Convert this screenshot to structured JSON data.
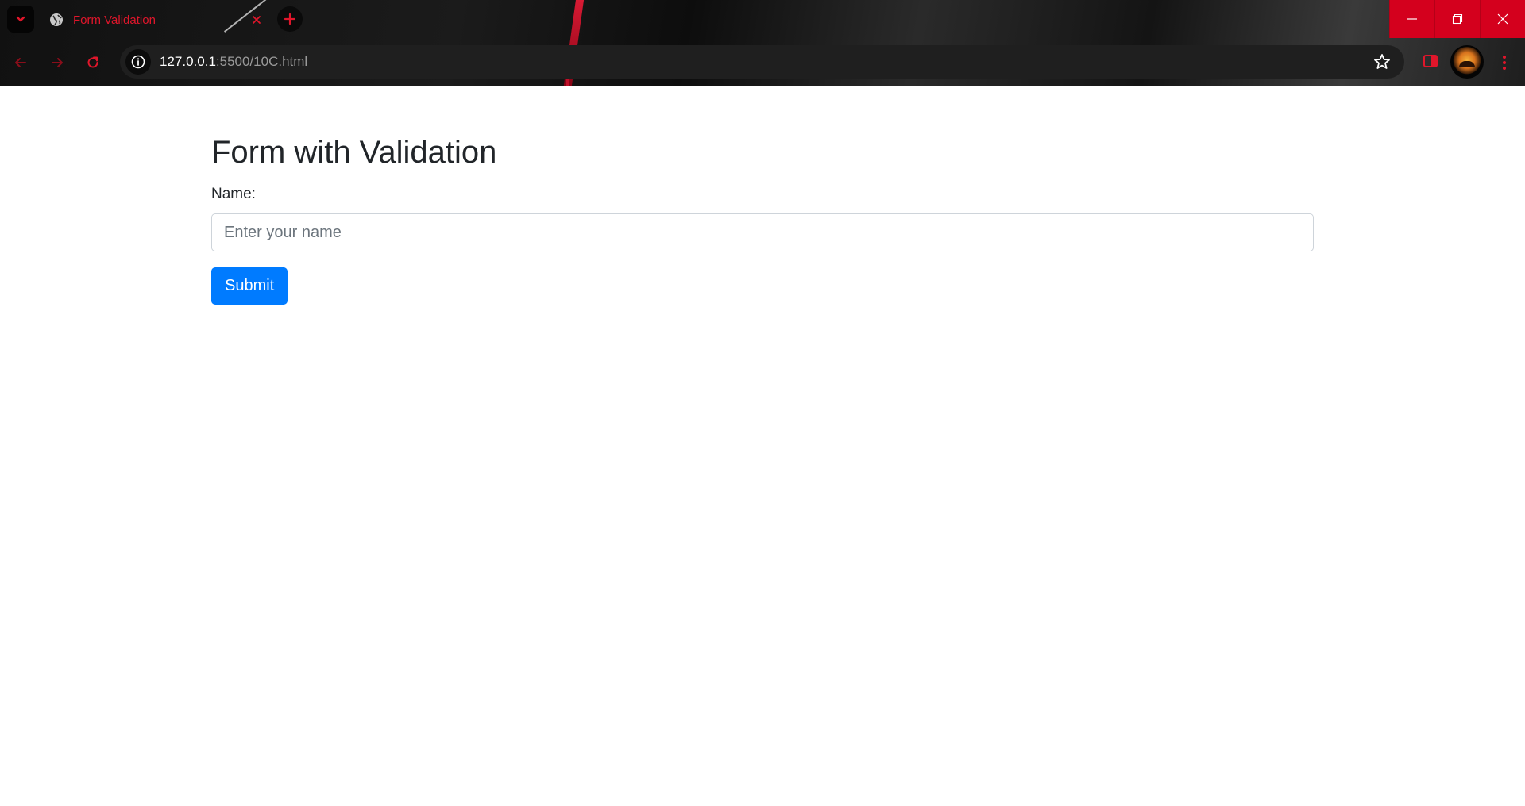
{
  "browser": {
    "tab": {
      "title": "Form Validation",
      "icon": "globe-icon"
    },
    "address_bar": {
      "host": "127.0.0.1",
      "path": ":5500/10C.html"
    },
    "colors": {
      "accent": "#e0162b",
      "window_controls_bg": "#d4001d"
    }
  },
  "page": {
    "heading": "Form with Validation",
    "name_label": "Name:",
    "name_input": {
      "value": "",
      "placeholder": "Enter your name"
    },
    "submit_label": "Submit",
    "colors": {
      "primary_button": "#007bff"
    }
  }
}
